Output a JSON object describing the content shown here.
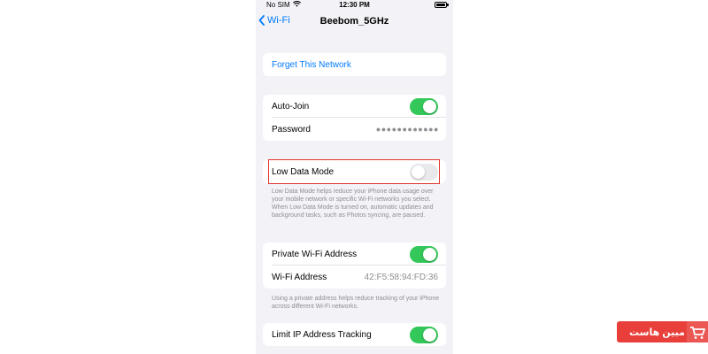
{
  "status_bar": {
    "carrier": "No SIM",
    "time": "12:30 PM"
  },
  "nav": {
    "back_label": "Wi-Fi",
    "title": "Beebom_5GHz"
  },
  "forget": {
    "label": "Forget This Network"
  },
  "auto_join": {
    "label": "Auto-Join",
    "on": true
  },
  "password": {
    "label": "Password",
    "masked": "●●●●●●●●●●●●"
  },
  "low_data": {
    "label": "Low Data Mode",
    "on": false,
    "footnote": "Low Data Mode helps reduce your iPhone data usage over your mobile network or specific Wi-Fi networks you select. When Low Data Mode is turned on, automatic updates and background tasks, such as Photos syncing, are paused."
  },
  "private_address": {
    "label": "Private Wi-Fi Address",
    "on": true,
    "address_label": "Wi-Fi Address",
    "address_value": "42:F5:58:94:FD:36",
    "footnote": "Using a private address helps reduce tracking of your iPhone across different Wi-Fi networks."
  },
  "limit_ip": {
    "label": "Limit IP Address Tracking",
    "on": true
  },
  "watermark": {
    "text": "مبین هاست"
  },
  "colors": {
    "accent": "#007aff",
    "toggle_on": "#34c759",
    "highlight": "#e2332d",
    "watermark_bg": "#e83f3a"
  }
}
